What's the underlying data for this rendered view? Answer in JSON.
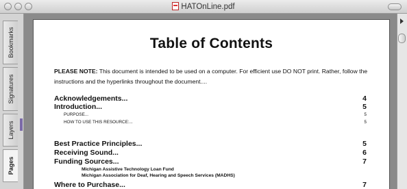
{
  "window": {
    "title": "HATOnLine.pdf"
  },
  "drawer_tabs": [
    {
      "label": "Bookmarks",
      "icon": "bookmark-icon"
    },
    {
      "label": "Signatures",
      "icon": "signature-icon"
    },
    {
      "label": "Layers",
      "icon": "layers-icon"
    },
    {
      "label": "Pages",
      "icon": "pages-icon",
      "active": true
    }
  ],
  "document": {
    "title": "Table of Contents",
    "note_bold": "PLEASE NOTE:",
    "note_text": " This document is intended to be used on a computer. For efficient use DO NOT print. Rather, follow the instructions and the hyperlinks throughout the document....",
    "toc": [
      {
        "text": "Acknowledgements...",
        "page": "4",
        "level": "h"
      },
      {
        "text": "Introduction...",
        "page": "5",
        "level": "h"
      },
      {
        "text": "Purpose...",
        "page": "5",
        "level": "sc"
      },
      {
        "text": "How to use this resource:...",
        "page": "5",
        "level": "sc"
      },
      {
        "text": "Best Practice Principles...",
        "page": "5",
        "level": "h"
      },
      {
        "text": "Receiving Sound...",
        "page": "6",
        "level": "h"
      },
      {
        "text": "Funding Sources...",
        "page": "7",
        "level": "h"
      },
      {
        "text": "Michigan Assistive Technology Loan Fund",
        "page": "",
        "level": "sub"
      },
      {
        "text": "Michigan Association for Deaf, Hearing and Speech Services (MADHS)",
        "page": "",
        "level": "sub"
      },
      {
        "text": "Where to Purchase...",
        "page": "7",
        "level": "h"
      }
    ]
  }
}
